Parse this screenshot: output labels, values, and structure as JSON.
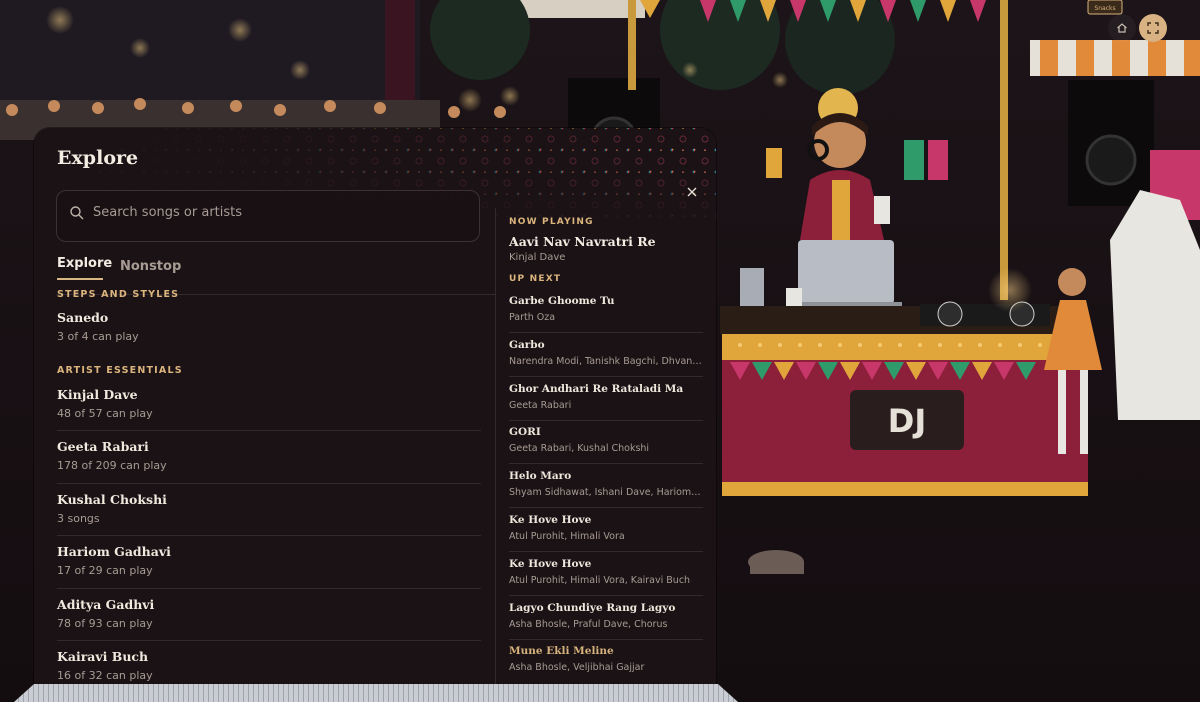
{
  "scene": {
    "dj_sign": "DJ",
    "snacks_sign": "Snacks"
  },
  "top_buttons": {
    "home_icon": "home-icon",
    "fullscreen_icon": "fullscreen-icon"
  },
  "explore": {
    "title": "Explore",
    "close_icon": "close-icon",
    "search": {
      "placeholder": "Search songs or artists",
      "value": ""
    },
    "tabs": [
      {
        "label": "Explore",
        "selected": true
      },
      {
        "label": "Nonstop",
        "selected": false
      }
    ],
    "sections": [
      {
        "heading": "STEPS AND STYLES",
        "items": [
          {
            "title": "Sanedo",
            "subtitle": "3 of 4 can play"
          }
        ]
      },
      {
        "heading": "ARTIST ESSENTIALS",
        "items": [
          {
            "title": "Kinjal Dave",
            "subtitle": "48 of 57 can play"
          },
          {
            "title": "Geeta Rabari",
            "subtitle": "178 of 209 can play"
          },
          {
            "title": "Kushal Chokshi",
            "subtitle": "3 songs"
          },
          {
            "title": "Hariom Gadhavi",
            "subtitle": "17 of 29 can play"
          },
          {
            "title": "Aditya Gadhvi",
            "subtitle": "78 of 93 can play"
          },
          {
            "title": "Kairavi Buch",
            "subtitle": "16 of 32 can play"
          }
        ]
      }
    ]
  },
  "queue": {
    "now_playing_label": "NOW PLAYING",
    "now_playing": {
      "title": "Aavi Nav Navratri Re",
      "artist": "Kinjal Dave"
    },
    "up_next_label": "UP NEXT",
    "up_next": [
      {
        "title": "Garbe Ghoome Tu",
        "artist": "Parth Oza"
      },
      {
        "title": "Garbo",
        "artist": "Narendra Modi, Tanishk Bagchi, Dhvani ..."
      },
      {
        "title": "Ghor Andhari Re Rataladi Ma",
        "artist": "Geeta Rabari"
      },
      {
        "title": "GORI",
        "artist": "Geeta Rabari, Kushal Chokshi"
      },
      {
        "title": "Helo Maro",
        "artist": "Shyam Sidhawat, Ishani Dave, Hariom ..."
      },
      {
        "title": "Ke Hove Hove",
        "artist": "Atul Purohit, Himali Vora"
      },
      {
        "title": "Ke Hove Hove",
        "artist": "Atul Purohit, Himali Vora, Kairavi Buch"
      },
      {
        "title": "Lagyo Chundiye Rang Lagyo",
        "artist": "Asha Bhosle, Praful Dave, Chorus"
      },
      {
        "title": "Mune Ekli Meline",
        "artist": "Asha Bhosle, Veljibhai Gajjar",
        "highlighted": true
      }
    ]
  },
  "colors": {
    "accent": "#dcb57e",
    "panel_bg": "#1a1215",
    "booth_red": "#8c1f3a",
    "booth_gold": "#e0a63c"
  }
}
